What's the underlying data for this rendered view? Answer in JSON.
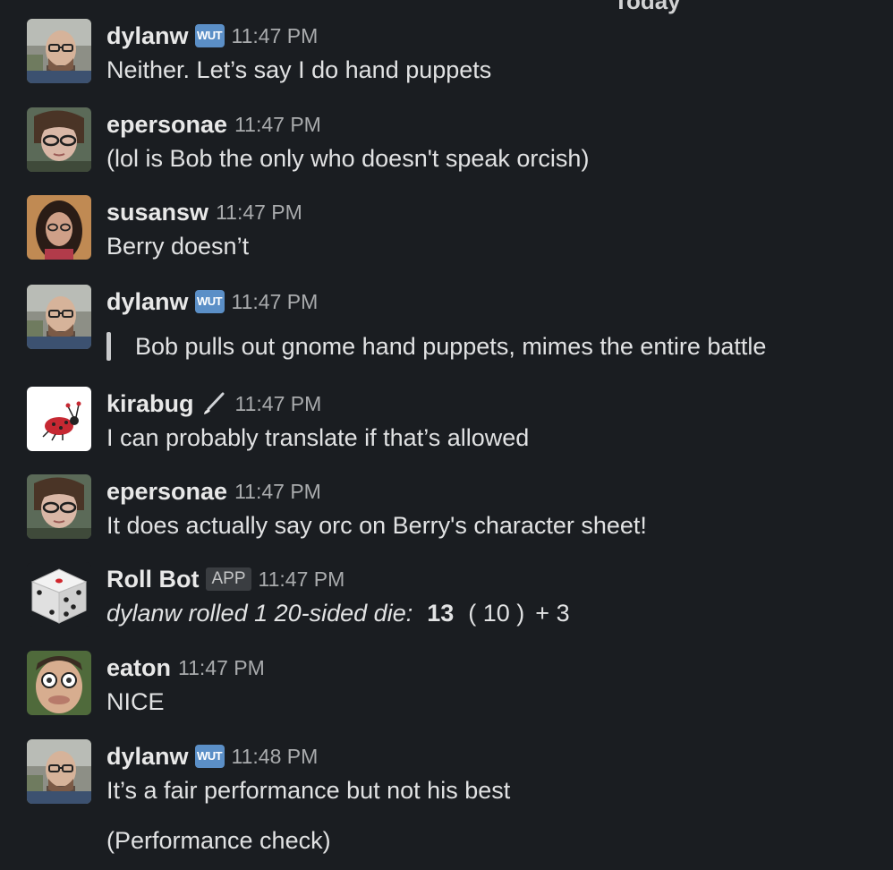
{
  "divider": {
    "label": "Today"
  },
  "messages": [
    {
      "user": "dylanw",
      "badge": "WUT",
      "time": "11:47 PM",
      "text": "Neither. Let’s say I do hand puppets",
      "avatar": "bald-man-glasses-avatar"
    },
    {
      "user": "epersonae",
      "time": "11:47 PM",
      "text": "(lol is Bob the only who doesn't speak orcish)",
      "avatar": "woman-glasses-avatar"
    },
    {
      "user": "susansw",
      "time": "11:47 PM",
      "text": "Berry doesn’t",
      "avatar": "dark-hair-woman-avatar"
    },
    {
      "user": "dylanw",
      "badge": "WUT",
      "time": "11:47 PM",
      "quote": "Bob pulls out gnome hand puppets, mimes the entire battle",
      "avatar": "bald-man-glasses-avatar"
    },
    {
      "user": "kirabug",
      "status_icon": "paintbrush-icon",
      "time": "11:47 PM",
      "text": "I can probably translate if that’s allowed",
      "avatar": "ladybug-avatar"
    },
    {
      "user": "epersonae",
      "time": "11:47 PM",
      "text": "It does actually say orc on Berry's character sheet!",
      "avatar": "woman-glasses-avatar"
    },
    {
      "user": "Roll Bot",
      "badge": "APP",
      "time": "11:47 PM",
      "roll": {
        "description": "dylanw rolled 1 20-sided die:",
        "total": "13",
        "dice": "( 10 )",
        "modifier": "+ 3"
      },
      "avatar": "die-avatar"
    },
    {
      "user": "eaton",
      "time": "11:47 PM",
      "text": "NICE",
      "avatar": "man-face-avatar"
    },
    {
      "user": "dylanw",
      "badge": "WUT",
      "time": "11:48 PM",
      "text": "It’s a fair performance but not his best",
      "extra": "(Performance check)",
      "avatar": "bald-man-glasses-avatar"
    }
  ],
  "colors": {
    "background": "#1a1d21",
    "text": "#e1e2e3",
    "timestamp": "#a9abad",
    "wut_badge": "#5b8fc7"
  }
}
